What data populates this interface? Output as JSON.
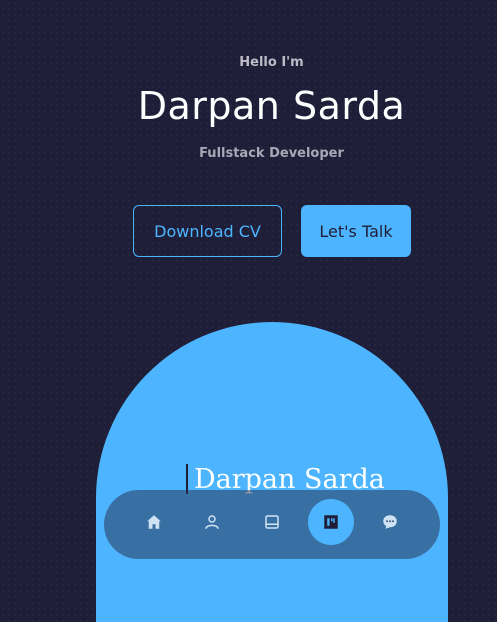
{
  "intro": {
    "greeting": "Hello I'm",
    "name": "Darpan Sarda",
    "role": "Fullstack Developer"
  },
  "actions": {
    "download_cv": "Download CV",
    "lets_talk": "Let's Talk"
  },
  "hero": {
    "signature": "Darpan Sarda"
  },
  "nav": {
    "items": [
      {
        "icon": "home-icon",
        "active": false
      },
      {
        "icon": "user-icon",
        "active": false
      },
      {
        "icon": "book-icon",
        "active": false
      },
      {
        "icon": "briefcase-icon",
        "active": true
      },
      {
        "icon": "chat-icon",
        "active": false
      }
    ]
  },
  "colors": {
    "background": "#1f1e38",
    "accent": "#4db5ff"
  }
}
